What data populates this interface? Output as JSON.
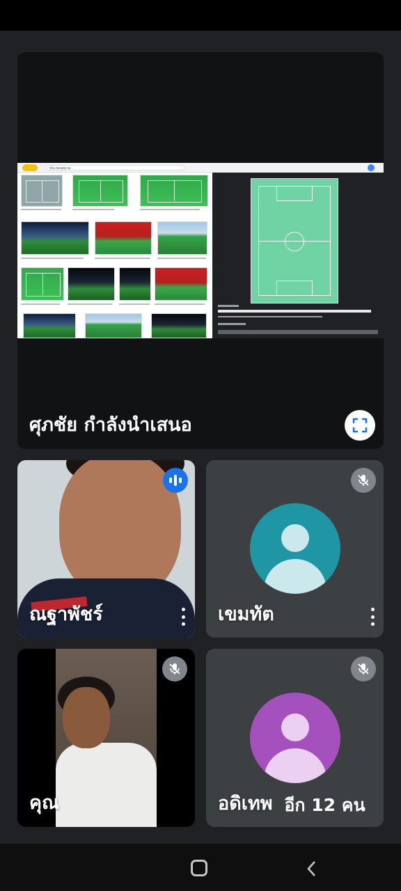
{
  "presentation": {
    "presenter_label": "ศุภชัย กำลังนำเสนอ",
    "search_query": "ประกอบสนาม"
  },
  "participants": [
    {
      "name": "ณฐาพัชร์",
      "state": "speaking"
    },
    {
      "name": "เขมทัต",
      "state": "muted",
      "avatar_color": "#1e96a3"
    },
    {
      "name": "คุณ",
      "state": "muted"
    },
    {
      "name": "อดิเทพ",
      "state": "muted",
      "avatar_color": "#a450bd"
    }
  ],
  "more_participants": "อีก 12 คน",
  "colors": {
    "background": "#202124",
    "tile": "#3c4043",
    "speaking_blue": "#1a73e8",
    "muted_grey": "#80868b"
  }
}
